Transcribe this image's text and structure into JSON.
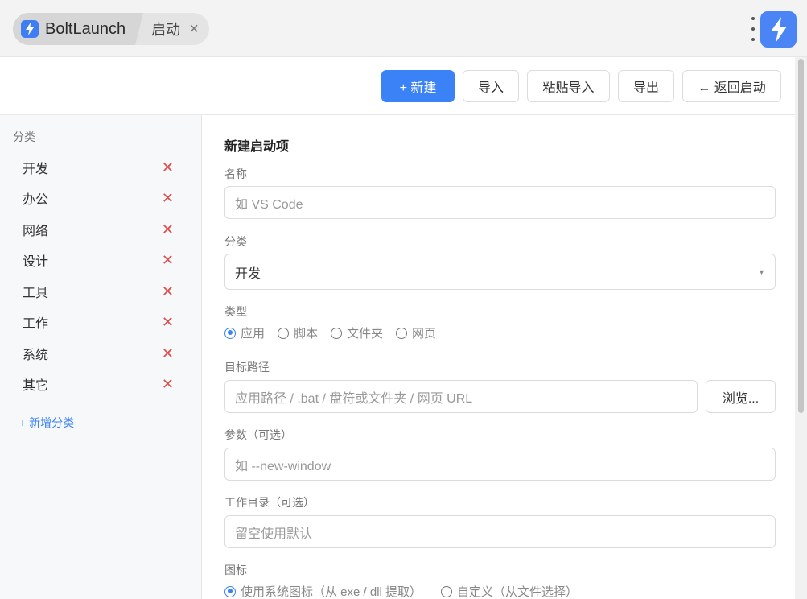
{
  "tabs": {
    "app_name": "BoltLaunch",
    "current_tab": "启动",
    "close_icon": "close-icon"
  },
  "toolbar": {
    "new_label": "+ 新建",
    "import_label": "导入",
    "paste_import_label": "粘贴导入",
    "export_label": "导出",
    "back_label": "← 返回启动"
  },
  "sidebar": {
    "title": "分类",
    "items": [
      {
        "label": "开发"
      },
      {
        "label": "办公"
      },
      {
        "label": "网络"
      },
      {
        "label": "设计"
      },
      {
        "label": "工具"
      },
      {
        "label": "工作"
      },
      {
        "label": "系统"
      },
      {
        "label": "其它"
      }
    ],
    "add_label": "+ 新增分类"
  },
  "form": {
    "title": "新建启动项",
    "name_label": "名称",
    "name_placeholder": "如 VS Code",
    "category_label": "分类",
    "category_value": "开发",
    "type_label": "类型",
    "type_options": [
      "应用",
      "脚本",
      "文件夹",
      "网页"
    ],
    "type_selected": "应用",
    "target_label": "目标路径",
    "target_placeholder": "应用路径 / .bat / 盘符或文件夹 / 网页 URL",
    "browse_label": "浏览...",
    "args_label": "参数（可选）",
    "args_placeholder": "如 --new-window",
    "workdir_label": "工作目录（可选）",
    "workdir_placeholder": "留空使用默认",
    "icon_label": "图标",
    "icon_options": [
      "使用系统图标（从 exe / dll 提取）",
      "自定义（从文件选择）"
    ],
    "icon_selected": "使用系统图标（从 exe / dll 提取）"
  },
  "colors": {
    "accent": "#3a82f6",
    "delete": "#e04b4b",
    "sidebar_bg": "#f7f8fa",
    "topbar_bg": "#f3f3f3"
  }
}
